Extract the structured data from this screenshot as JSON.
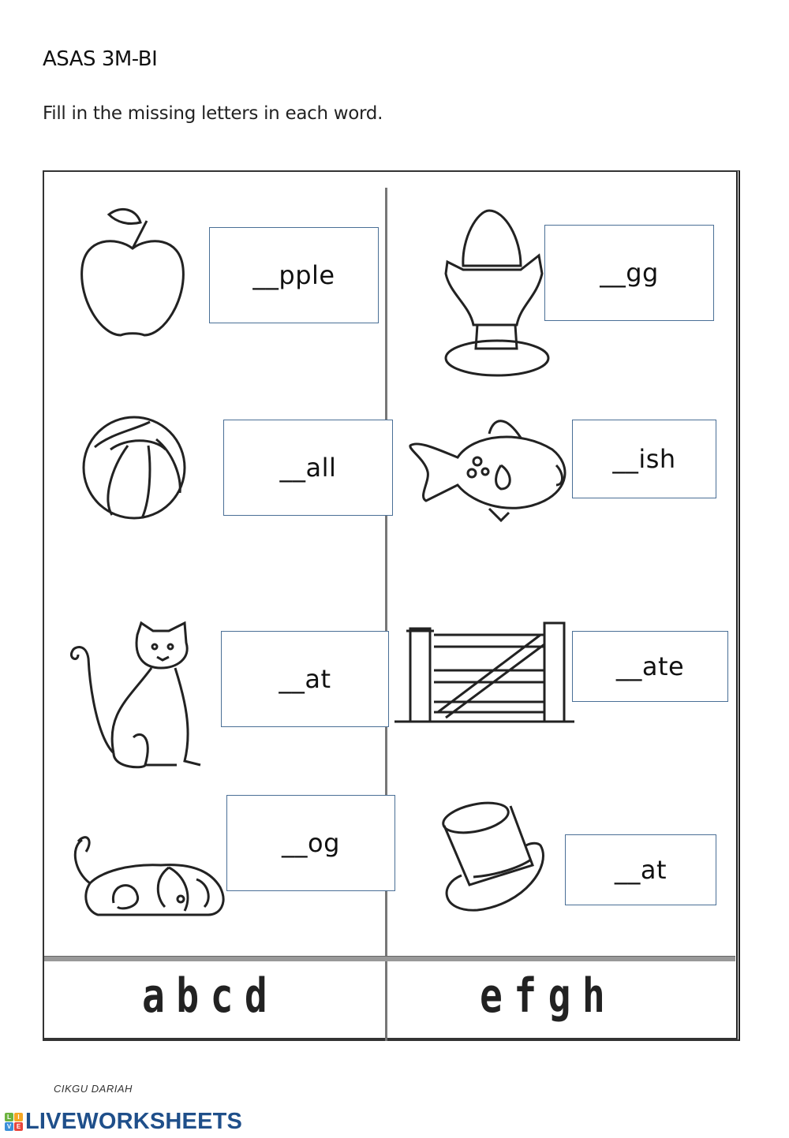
{
  "header": {
    "title": "ASAS 3M-BI",
    "instruction": "Fill in the missing letters in each word."
  },
  "items": [
    {
      "picture": "apple",
      "word": "__pple"
    },
    {
      "picture": "egg",
      "word": "__gg"
    },
    {
      "picture": "ball",
      "word": "__all"
    },
    {
      "picture": "fish",
      "word": "__ish"
    },
    {
      "picture": "cat",
      "word": "__at"
    },
    {
      "picture": "gate",
      "word": "__ate"
    },
    {
      "picture": "dog",
      "word": "__og"
    },
    {
      "picture": "hat",
      "word": "__at"
    }
  ],
  "letter_bank": {
    "left": "abcd",
    "right": "efgh"
  },
  "footer": {
    "author": "CIKGU DARIAH",
    "brand": "LIVEWORKSHEETS",
    "brand_icon_letters": [
      "L",
      "I",
      "V",
      "E"
    ],
    "brand_color": "#1f4f8a",
    "box_border_color": "#4a6f96"
  }
}
